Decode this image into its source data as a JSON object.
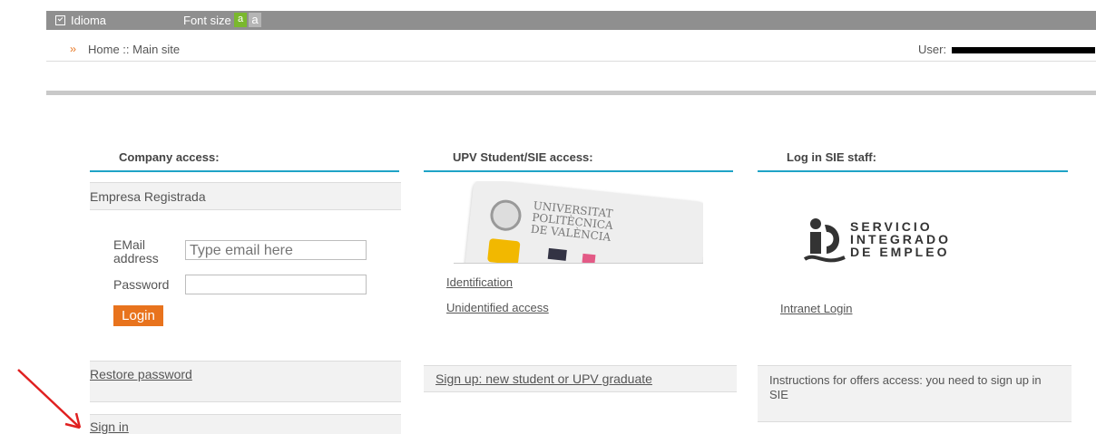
{
  "topbar": {
    "idioma_label": "Idioma",
    "font_size_label": "Font size",
    "font_small_glyph": "a",
    "font_large_glyph": "a"
  },
  "breadcrumb": {
    "arrows": "››",
    "path": "Home :: Main site",
    "user_label": "User:"
  },
  "columns": {
    "company": {
      "title": "Company access:",
      "section_label": "Empresa Registrada",
      "email_label": "EMail address",
      "email_placeholder": "Type email here",
      "password_label": "Password",
      "login_button": "Login",
      "restore_password": "Restore password",
      "sign_in": "Sign in"
    },
    "student": {
      "title": "UPV Student/SIE access:",
      "card_text": "UNIVERSITAT POLITÈCNICA DE VALÈNCIA",
      "identification_link": "Identification",
      "unidentified_link": "Unidentified access",
      "signup_link": "Sign up: new student or UPV graduate"
    },
    "staff": {
      "title": "Log in SIE staff:",
      "logo_lines": [
        "SERVICIO",
        "INTEGRADO",
        "DE EMPLEO"
      ],
      "intranet_link": "Intranet Login",
      "instructions": "Instructions for offers access: you need to sign up in SIE"
    }
  },
  "colors": {
    "accent_orange": "#e8731d",
    "accent_blue": "#1fa3c6",
    "topbar_grey": "#8f8f8f",
    "annotation_red": "#e02020"
  }
}
